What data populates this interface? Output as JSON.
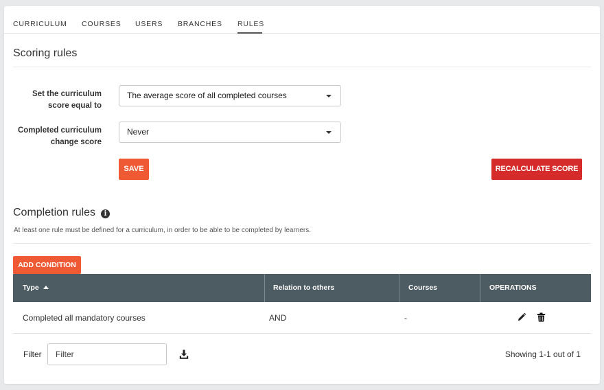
{
  "tabs": [
    {
      "label": "CURRICULUM"
    },
    {
      "label": "COURSES"
    },
    {
      "label": "USERS"
    },
    {
      "label": "BRANCHES"
    },
    {
      "label": "RULES",
      "active": true
    }
  ],
  "scoring": {
    "title": "Scoring rules",
    "score_label_line1": "Set the curriculum",
    "score_label_line2": "score equal to",
    "score_value": "The average score of all completed courses",
    "change_label_line1": "Completed curriculum",
    "change_label_line2": "change score",
    "change_value": "Never",
    "save_label": "SAVE",
    "recalc_label": "RECALCULATE SCORE"
  },
  "completion": {
    "title": "Completion rules",
    "note": "At least one rule must be defined for a curriculum, in order to be able to be completed by learners.",
    "add_label": "ADD CONDITION"
  },
  "table": {
    "headers": {
      "type": "Type",
      "relation": "Relation to others",
      "courses": "Courses",
      "operations": "OPERATIONS"
    },
    "rows": [
      {
        "type": "Completed all mandatory courses",
        "relation": "AND",
        "courses": "-"
      }
    ]
  },
  "footer": {
    "filter_label": "Filter",
    "filter_placeholder": "Filter",
    "showing": "Showing 1-1 out of 1"
  },
  "colors": {
    "primary_orange": "#ef5a34",
    "danger_red": "#d62b2b",
    "table_header": "#4d5b62"
  },
  "icons": [
    "sort-up-icon",
    "info-icon",
    "edit-pencil-icon",
    "delete-trash-icon",
    "download-icon",
    "chevron-down-icon"
  ]
}
